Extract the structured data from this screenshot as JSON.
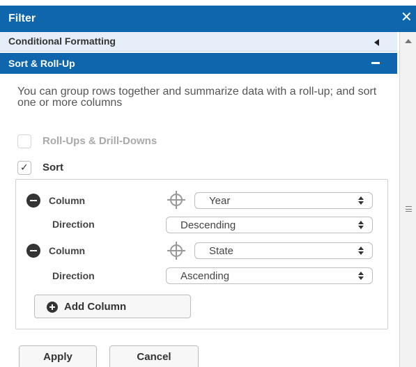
{
  "panel": {
    "title": "Filter",
    "close_glyph": "✕"
  },
  "sections": {
    "conditional_formatting": {
      "label": "Conditional Formatting"
    },
    "sort_rollup": {
      "label": "Sort & Roll-Up"
    }
  },
  "description": "You can group rows together and summarize data with a roll-up; and sort one or more columns",
  "options": {
    "rollups": {
      "label": "Roll-Ups & Drill-Downs",
      "checked": false
    },
    "sort": {
      "label": "Sort",
      "checked": true,
      "check_glyph": "✓"
    }
  },
  "sort_rows": [
    {
      "column_label": "Column",
      "column_value": "Year",
      "direction_label": "Direction",
      "direction_value": "Descending"
    },
    {
      "column_label": "Column",
      "column_value": "State",
      "direction_label": "Direction",
      "direction_value": "Ascending"
    }
  ],
  "add_column_label": "Add Column",
  "buttons": {
    "apply": "Apply",
    "cancel": "Cancel"
  },
  "colors": {
    "header_bg": "#0f66ac",
    "section_inactive_bg": "#e6eff9"
  },
  "icons": {
    "remove": "minus-circle-icon",
    "target": "crosshair-icon",
    "add": "plus-circle-icon"
  }
}
